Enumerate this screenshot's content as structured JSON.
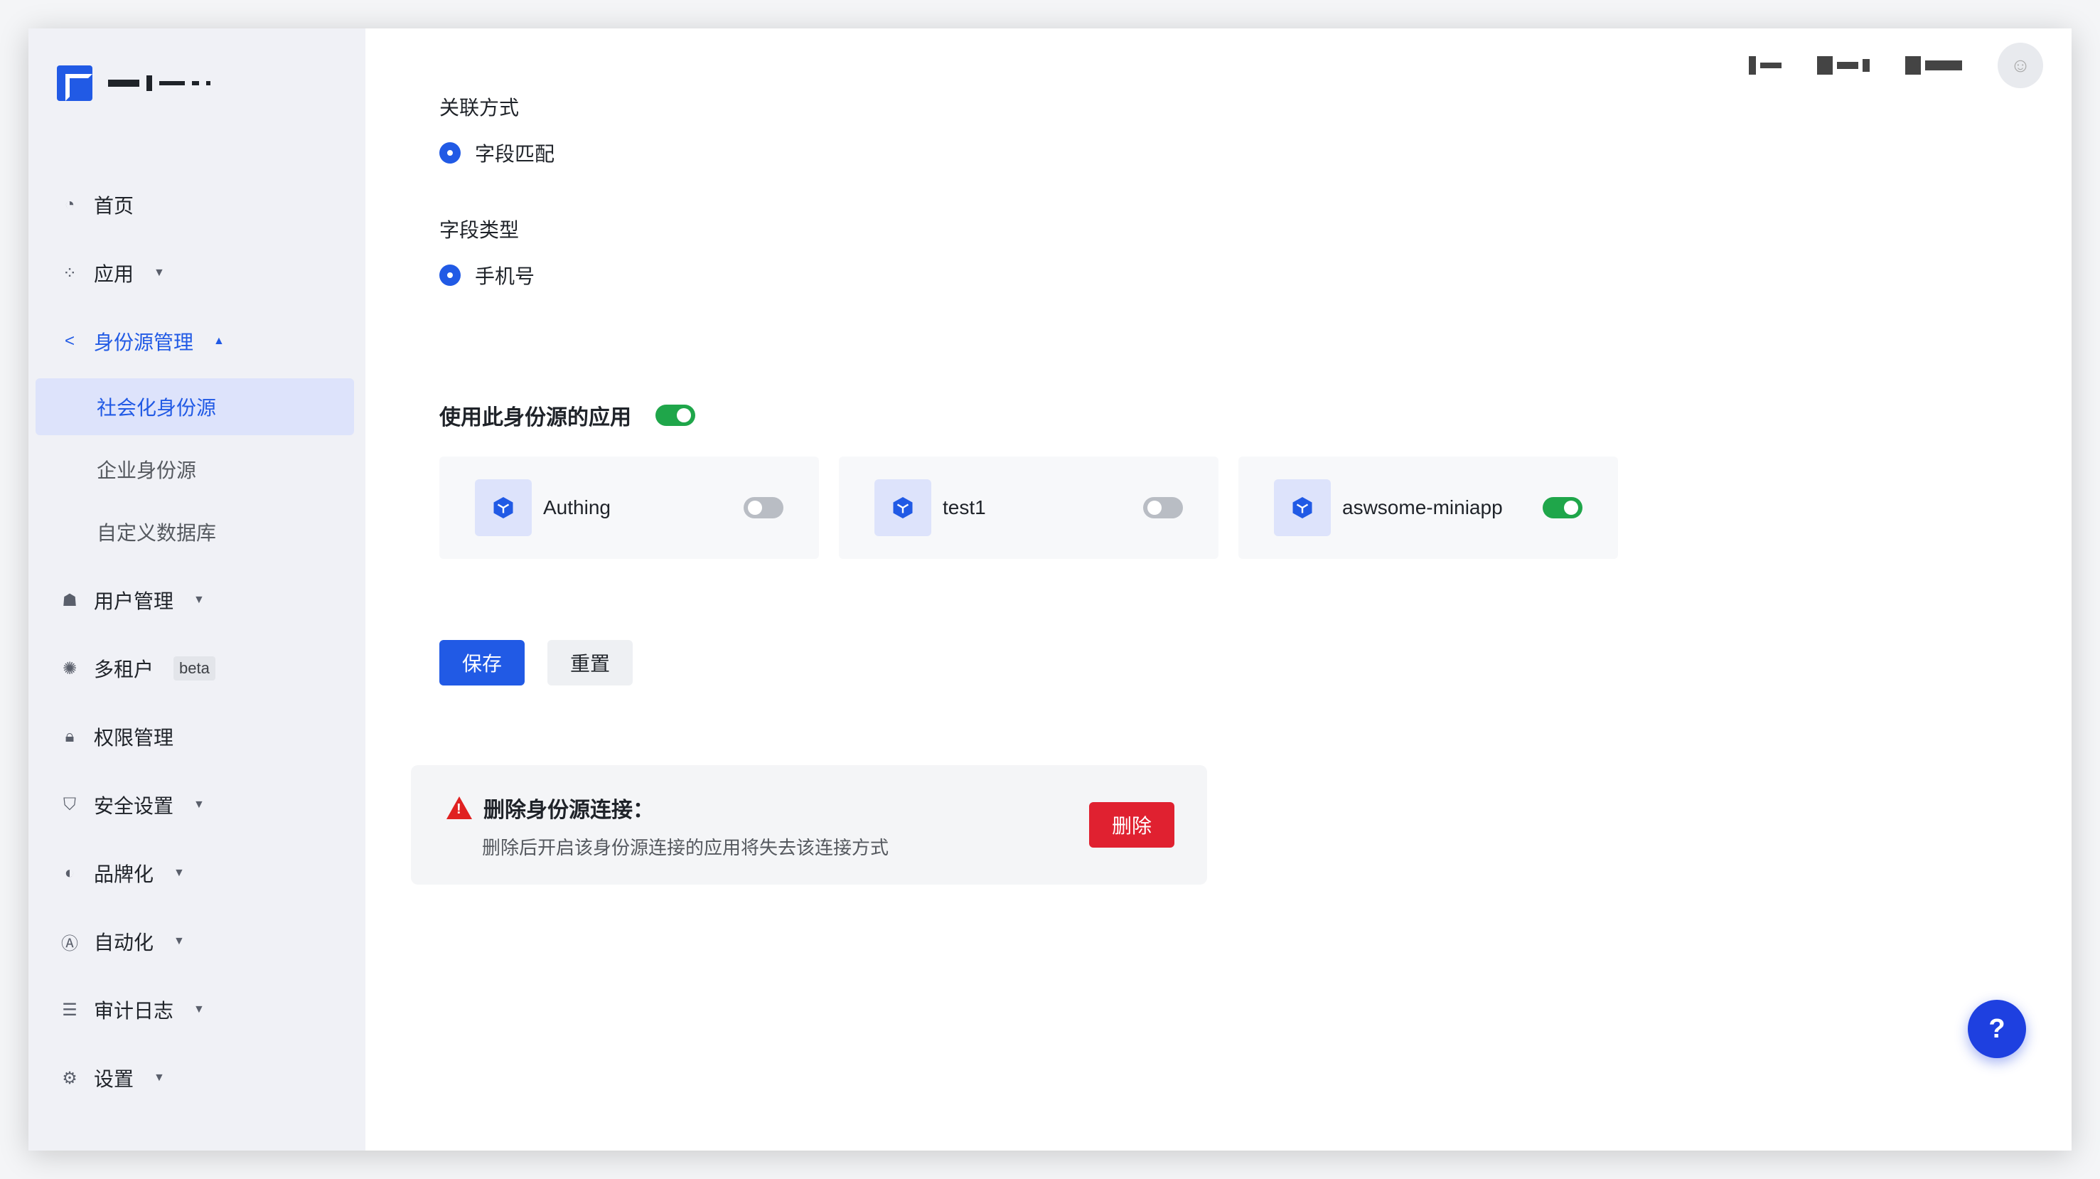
{
  "sidebar": {
    "nav": [
      {
        "label": "首页",
        "icon": "pie-chart-icon"
      },
      {
        "label": "应用",
        "icon": "apps-icon"
      },
      {
        "label": "身份源管理",
        "icon": "share-icon"
      },
      {
        "label": "用户管理",
        "icon": "user-group-icon"
      },
      {
        "label": "多租户",
        "icon": "tenant-icon",
        "badge": "beta"
      },
      {
        "label": "权限管理",
        "icon": "lock-icon"
      },
      {
        "label": "安全设置",
        "icon": "shield-icon"
      },
      {
        "label": "品牌化",
        "icon": "brand-icon"
      },
      {
        "label": "自动化",
        "icon": "automation-icon"
      },
      {
        "label": "审计日志",
        "icon": "log-icon"
      },
      {
        "label": "设置",
        "icon": "gear-icon"
      }
    ],
    "sub": [
      {
        "label": "社会化身份源"
      },
      {
        "label": "企业身份源"
      },
      {
        "label": "自定义数据库"
      }
    ]
  },
  "form": {
    "link_method_label": "关联方式",
    "link_method_value": "字段匹配",
    "field_type_label": "字段类型",
    "field_type_value": "手机号"
  },
  "apps_section": {
    "title": "使用此身份源的应用",
    "enabled": true,
    "apps": [
      {
        "name": "Authing",
        "enabled": false
      },
      {
        "name": "test1",
        "enabled": false
      },
      {
        "name": "aswsome-miniapp",
        "enabled": true
      }
    ]
  },
  "actions": {
    "save": "保存",
    "reset": "重置"
  },
  "danger": {
    "title": "删除身份源连接：",
    "description": "删除后开启该身份源连接的应用将失去该连接方式",
    "delete": "删除"
  },
  "help": "?",
  "colors": {
    "primary": "#215ae5",
    "success": "#1fa64a",
    "danger": "#e02130"
  }
}
